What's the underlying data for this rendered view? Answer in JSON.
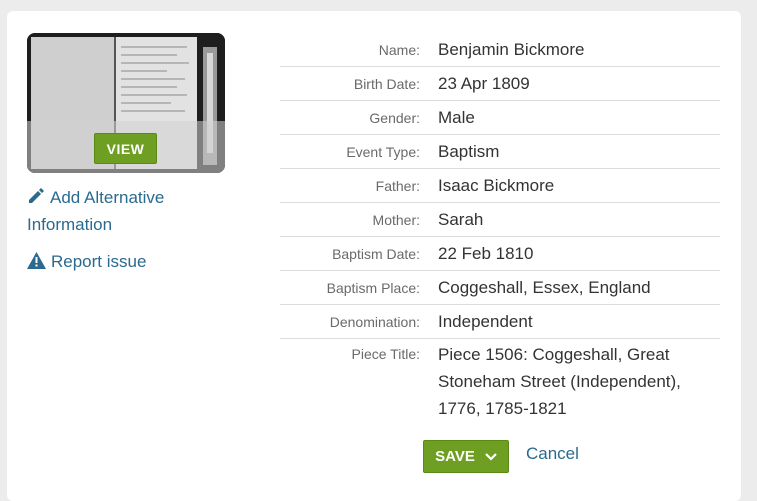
{
  "thumbnail": {
    "view_label": "VIEW"
  },
  "links": {
    "add_alternative": "Add Alternative Information",
    "report_issue": "Report issue"
  },
  "record": [
    {
      "label": "Name:",
      "value": "Benjamin Bickmore"
    },
    {
      "label": "Birth Date:",
      "value": "23 Apr 1809"
    },
    {
      "label": "Gender:",
      "value": "Male"
    },
    {
      "label": "Event Type:",
      "value": "Baptism"
    },
    {
      "label": "Father:",
      "value": "Isaac Bickmore"
    },
    {
      "label": "Mother:",
      "value": "Sarah"
    },
    {
      "label": "Baptism Date:",
      "value": "22 Feb 1810"
    },
    {
      "label": "Baptism Place:",
      "value": "Coggeshall, Essex, England"
    },
    {
      "label": "Denomination:",
      "value": "Independent"
    },
    {
      "label": "Piece Title:",
      "value": "Piece 1506: Coggeshall, Great Stoneham Street (Independent), 1776, 1785-1821"
    }
  ],
  "actions": {
    "save_label": "SAVE",
    "cancel_label": "Cancel"
  },
  "colors": {
    "accent": "#6e9e22",
    "link": "#2a6a8e"
  },
  "icons": {
    "add": "pencil-icon",
    "report": "warning-icon",
    "save_menu": "chevron-down-icon"
  }
}
